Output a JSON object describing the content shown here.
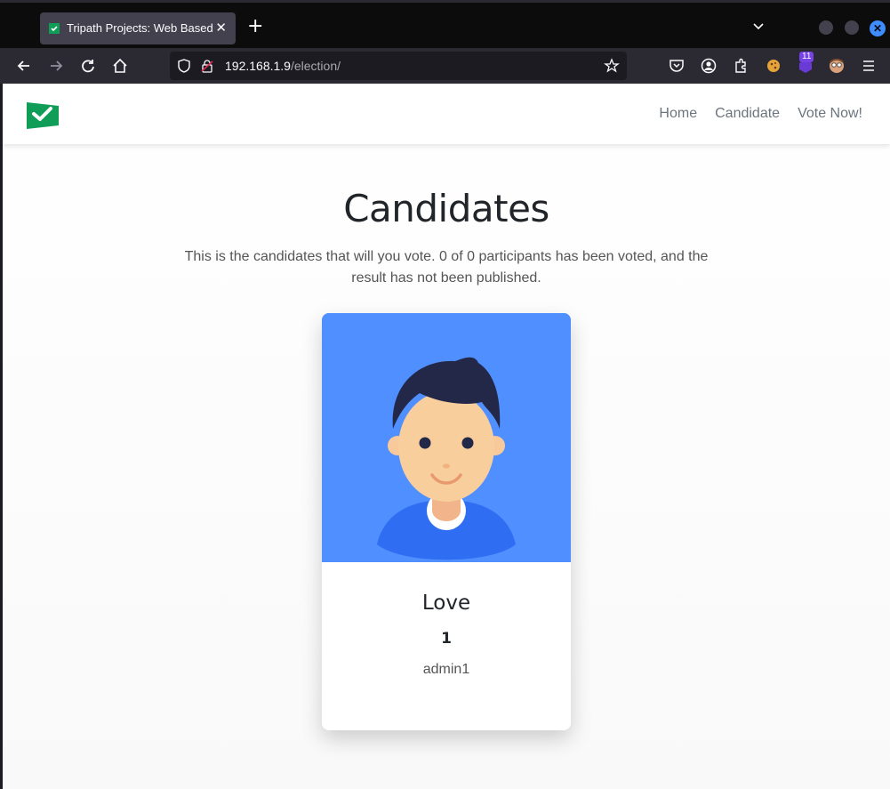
{
  "browser": {
    "tab_title": "Tripath Projects: Web Based",
    "url_host": "192.168.1.9",
    "url_path": "/election/",
    "extension_badge": "11"
  },
  "site": {
    "nav": [
      "Home",
      "Candidate",
      "Vote Now!"
    ],
    "brand_color": "#0f9d58"
  },
  "main": {
    "title": "Candidates",
    "description": "This is the candidates that will you vote. 0 of 0 participants has been voted, and the result has not been published."
  },
  "candidates": [
    {
      "name": "Love",
      "number": "1",
      "username": "admin1"
    }
  ]
}
